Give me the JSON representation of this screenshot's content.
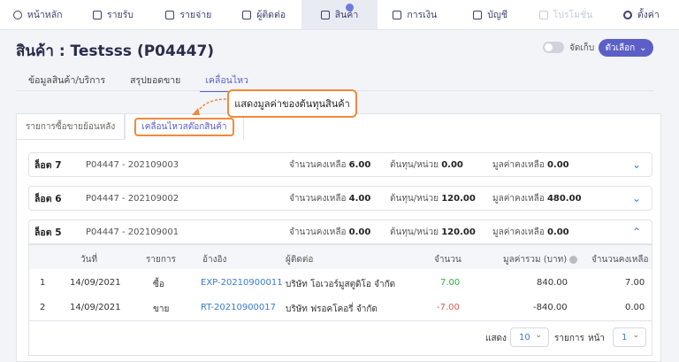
{
  "nav": {
    "items": [
      {
        "label": "หน้าหลัก",
        "icon": "home-icon"
      },
      {
        "label": "รายรับ",
        "icon": "income-icon"
      },
      {
        "label": "รายจ่าย",
        "icon": "expense-icon"
      },
      {
        "label": "ผู้ติดต่อ",
        "icon": "contact-icon"
      },
      {
        "label": "สินค้า",
        "icon": "box-icon"
      },
      {
        "label": "การเงิน",
        "icon": "money-icon"
      },
      {
        "label": "บัญชี",
        "icon": "ledger-icon"
      },
      {
        "label": "โปรโมชั่น",
        "icon": "megaphone-icon"
      },
      {
        "label": "ตั้งค่า",
        "icon": "gear-icon"
      }
    ]
  },
  "page": {
    "title": "สินค้า : Testsss (P04447)",
    "store_label": "จัดเก็บ",
    "options_label": "ตัวเลือก",
    "options_caret": "⌄"
  },
  "subtabs": [
    "ข้อมูลสินค้า/บริการ",
    "สรุปยอดขาย",
    "เคลื่อนไหว"
  ],
  "callout": "แสดงมูลค่าของต้นทุนสินค้า",
  "innertabs": [
    "รายการซื้อขายย้อนหลัง",
    "เคลื่อนไหวสต๊อกสินค้า"
  ],
  "lots": [
    {
      "name": "ล็อต 7",
      "code": "P04447 - 202109003",
      "qty_label": "จำนวนคงเหลือ",
      "qty": "6.00",
      "cost_label": "ต้นทุน/หน่วย",
      "cost": "0.00",
      "value_label": "มูลค่าคงเหลือ",
      "value": "0.00",
      "chev": "⌄"
    },
    {
      "name": "ล็อต 6",
      "code": "P04447 - 202109002",
      "qty_label": "จำนวนคงเหลือ",
      "qty": "4.00",
      "cost_label": "ต้นทุน/หน่วย",
      "cost": "120.00",
      "value_label": "มูลค่าคงเหลือ",
      "value": "480.00",
      "chev": "⌄"
    },
    {
      "name": "ล็อต 5",
      "code": "P04447 - 202109001",
      "qty_label": "จำนวนคงเหลือ",
      "qty": "0.00",
      "cost_label": "ต้นทุน/หน่วย",
      "cost": "120.00",
      "value_label": "มูลค่าคงเหลือ",
      "value": "0.00",
      "chev": "⌃"
    }
  ],
  "table": {
    "headers": [
      "วันที่",
      "รายการ",
      "อ้างอิง",
      "ผู้ติดต่อ",
      "จำนวน",
      "มูลค่ารวม (บาท)",
      "จำนวนคงเหลือ"
    ],
    "rows": [
      {
        "no": "1",
        "date": "14/09/2021",
        "type": "ซื้อ",
        "ref": "EXP-20210900011",
        "contact": "บริษัท โอเวอร์มูสตูดิโอ จำกัด",
        "qty": "7.00",
        "total": "840.00",
        "remain": "7.00"
      },
      {
        "no": "2",
        "date": "14/09/2021",
        "type": "ขาย",
        "ref": "RT-20210900017",
        "contact": "บริษัท ฟรอคโคอรี่ จำกัด",
        "qty": "-7.00",
        "total": "-840.00",
        "remain": "0.00"
      }
    ]
  },
  "pager": {
    "show_label": "แสดง",
    "per_page": "10",
    "items_label": "รายการ",
    "page_label": "หน้า",
    "page": "1",
    "caret": "⌄"
  }
}
